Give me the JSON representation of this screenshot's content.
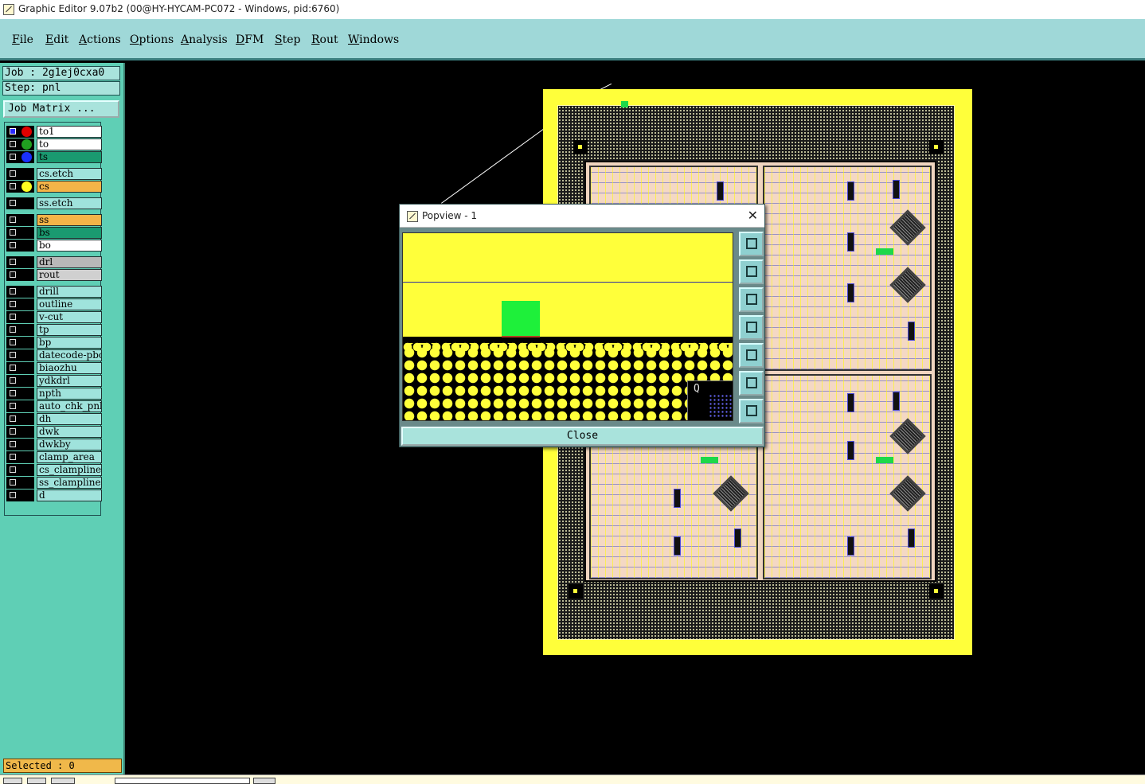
{
  "window": {
    "title": "Graphic Editor 9.07b2 (00@HY-HYCAM-PC072 - Windows, pid:6760)"
  },
  "menu": [
    "File",
    "Edit",
    "Actions",
    "Options",
    "Analysis",
    "DFM",
    "Step",
    "Rout",
    "Windows"
  ],
  "job": {
    "job_line": "Job : 2g1ej0cxa0",
    "step_line": "Step: pnl",
    "matrix_button": "Job Matrix ..."
  },
  "layers": [
    {
      "name": "to1",
      "bg": "#ffffff",
      "dot": "#e00000",
      "checked": true
    },
    {
      "name": "to",
      "bg": "#ffffff",
      "dot": "#20a020",
      "checked": false
    },
    {
      "name": "ts",
      "bg": "#1a9a70",
      "dot": "#1a30ff",
      "checked": false
    },
    {
      "name": "cs.etch",
      "bg": "#9fe3dc",
      "dot": "",
      "checked": false
    },
    {
      "name": "cs",
      "bg": "#f4b448",
      "dot": "#ffff20",
      "checked": false
    },
    {
      "name": "ss.etch",
      "bg": "#9fe3dc",
      "dot": "",
      "checked": false
    },
    {
      "name": "ss",
      "bg": "#f4b448",
      "dot": "",
      "checked": false
    },
    {
      "name": "bs",
      "bg": "#1a9a70",
      "dot": "",
      "checked": false
    },
    {
      "name": "bo",
      "bg": "#ffffff",
      "dot": "",
      "checked": false
    },
    {
      "name": "drl",
      "bg": "#b8b8b8",
      "dot": "",
      "checked": false
    },
    {
      "name": "rout",
      "bg": "#d0d0d0",
      "dot": "",
      "checked": false
    },
    {
      "name": "drill",
      "bg": "#9fe3dc",
      "dot": "",
      "checked": false
    },
    {
      "name": "outline",
      "bg": "#9fe3dc",
      "dot": "",
      "checked": false
    },
    {
      "name": "v-cut",
      "bg": "#9fe3dc",
      "dot": "",
      "checked": false
    },
    {
      "name": "tp",
      "bg": "#9fe3dc",
      "dot": "",
      "checked": false
    },
    {
      "name": "bp",
      "bg": "#9fe3dc",
      "dot": "",
      "checked": false
    },
    {
      "name": "datecode-pbc",
      "bg": "#9fe3dc",
      "dot": "",
      "checked": false
    },
    {
      "name": "biaozhu",
      "bg": "#9fe3dc",
      "dot": "",
      "checked": false
    },
    {
      "name": "ydkdrl",
      "bg": "#9fe3dc",
      "dot": "",
      "checked": false
    },
    {
      "name": "npth",
      "bg": "#9fe3dc",
      "dot": "",
      "checked": false
    },
    {
      "name": "auto_chk_pnl",
      "bg": "#9fe3dc",
      "dot": "",
      "checked": false
    },
    {
      "name": "dh",
      "bg": "#9fe3dc",
      "dot": "",
      "checked": false
    },
    {
      "name": "dwk",
      "bg": "#9fe3dc",
      "dot": "",
      "checked": false
    },
    {
      "name": "dwkby",
      "bg": "#9fe3dc",
      "dot": "",
      "checked": false
    },
    {
      "name": "clamp_area",
      "bg": "#9fe3dc",
      "dot": "",
      "checked": false
    },
    {
      "name": "cs_clampline",
      "bg": "#9fe3dc",
      "dot": "",
      "checked": false
    },
    {
      "name": "ss_clampline",
      "bg": "#9fe3dc",
      "dot": "",
      "checked": false
    },
    {
      "name": "d",
      "bg": "#9fe3dc",
      "dot": "",
      "checked": false
    }
  ],
  "status": {
    "selected": "Selected : 0"
  },
  "popview": {
    "title": "Popview - 1",
    "close_label": "Close",
    "viewer_label": "Q",
    "tools": [
      "zoom-copy-icon",
      "move-up-icon",
      "move-down-icon",
      "move-left-icon",
      "move-right-icon",
      "zoom-fit-icon",
      "pan-icon"
    ]
  },
  "colors": {
    "menubar": "#9fd8d8",
    "panel": "#5fcfb5",
    "board": "#ffff3a",
    "pad": "#1ed84a"
  }
}
